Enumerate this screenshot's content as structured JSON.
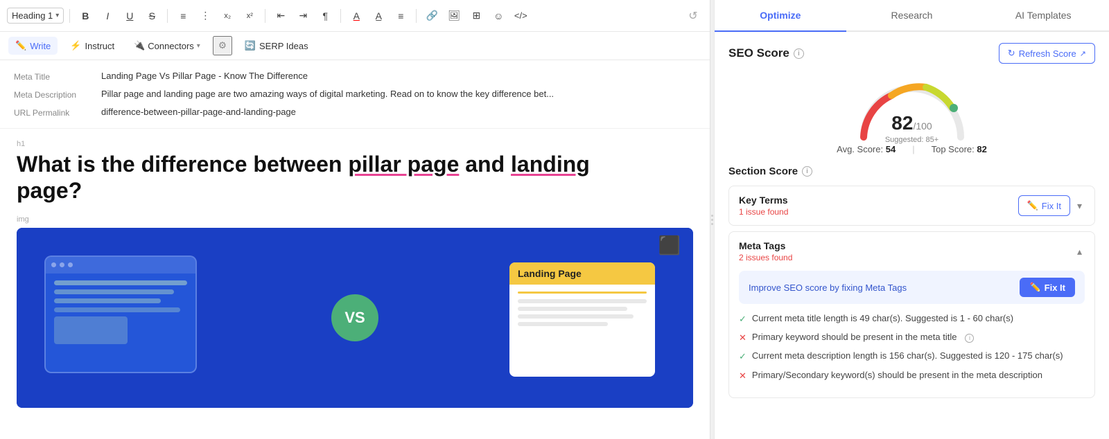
{
  "toolbar": {
    "heading_label": "Heading 1",
    "history_icon": "↺"
  },
  "secondary_toolbar": {
    "write_label": "Write",
    "instruct_label": "Instruct",
    "connectors_label": "Connectors",
    "serp_label": "SERP Ideas"
  },
  "meta": {
    "title_label": "Meta Title",
    "title_value": "Landing Page Vs Pillar Page - Know The Difference",
    "description_label": "Meta Description",
    "description_value": "Pillar page and landing page are two amazing ways of digital marketing. Read on to know the key difference bet...",
    "url_label": "URL Permalink",
    "url_value": "difference-between-pillar-page-and-landing-page"
  },
  "content": {
    "heading_tag": "h1",
    "heading_text": "What is the difference between pillar page and landing page?",
    "heading_underline1": "pillar page",
    "heading_underline2": "landing",
    "img_tag": "img",
    "image_vs_text": "VS",
    "landing_page_label": "Landing Page"
  },
  "right_panel": {
    "tab_optimize": "Optimize",
    "tab_research": "Research",
    "tab_ai_templates": "AI Templates",
    "seo_score_title": "SEO Score",
    "refresh_label": "Refresh Score",
    "gauge_score": "82",
    "gauge_total": "/100",
    "gauge_suggested": "Suggested: 85+",
    "avg_score_label": "Avg. Score:",
    "avg_score_value": "54",
    "top_score_label": "Top Score:",
    "top_score_value": "82",
    "section_score_title": "Section Score",
    "key_terms_title": "Key Terms",
    "key_terms_issue": "1 issue found",
    "key_terms_fix": "Fix It",
    "meta_tags_title": "Meta Tags",
    "meta_tags_issue": "2 issues found",
    "meta_tags_fix": "Fix It",
    "improve_text": "Improve SEO score by fixing Meta Tags",
    "check1": "Current meta title length is 49 char(s). Suggested is 1 - 60 char(s)",
    "cross1": "Primary keyword should be present in the meta title",
    "check2": "Current meta description length is 156 char(s). Suggested is 120 - 175 char(s)",
    "cross2": "Primary/Secondary keyword(s) should be present in the meta description"
  }
}
